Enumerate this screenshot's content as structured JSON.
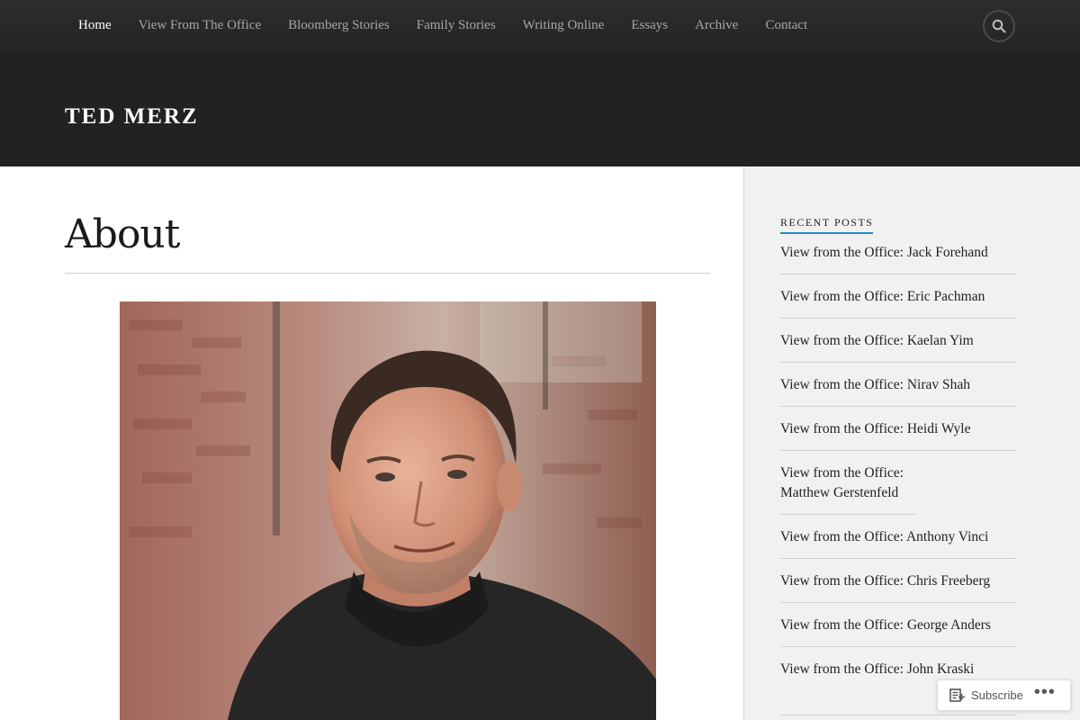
{
  "header": {
    "site_title": "TED MERZ",
    "nav": [
      {
        "label": "Home",
        "active": true
      },
      {
        "label": "View From The Office",
        "active": false
      },
      {
        "label": "Bloomberg Stories",
        "active": false
      },
      {
        "label": "Family Stories",
        "active": false
      },
      {
        "label": "Writing Online",
        "active": false
      },
      {
        "label": "Essays",
        "active": false
      },
      {
        "label": "Archive",
        "active": false
      },
      {
        "label": "Contact",
        "active": false
      }
    ],
    "search_icon": "search-icon"
  },
  "main": {
    "page_title": "About",
    "image_icon": "portrait-photo"
  },
  "sidebar": {
    "widget_title": "RECENT POSTS",
    "recent_posts": [
      "View from the Office: Jack Forehand",
      "View from the Office: Eric Pachman",
      "View from the Office: Kaelan Yim",
      "View from the Office: Nirav Shah",
      "View from the Office: Heidi Wyle",
      "View from the Office: Matthew Gerstenfeld",
      "View from the Office: Anthony Vinci",
      "View from the Office: Chris Freeberg",
      "View from the Office: George Anders",
      "View from the Office: John Kraski"
    ]
  },
  "subscribe": {
    "label": "Subscribe",
    "more": "•••"
  },
  "colors": {
    "header_bg": "#222222",
    "accent": "#1a8bc7",
    "sidebar_bg": "#f1f1f1"
  }
}
